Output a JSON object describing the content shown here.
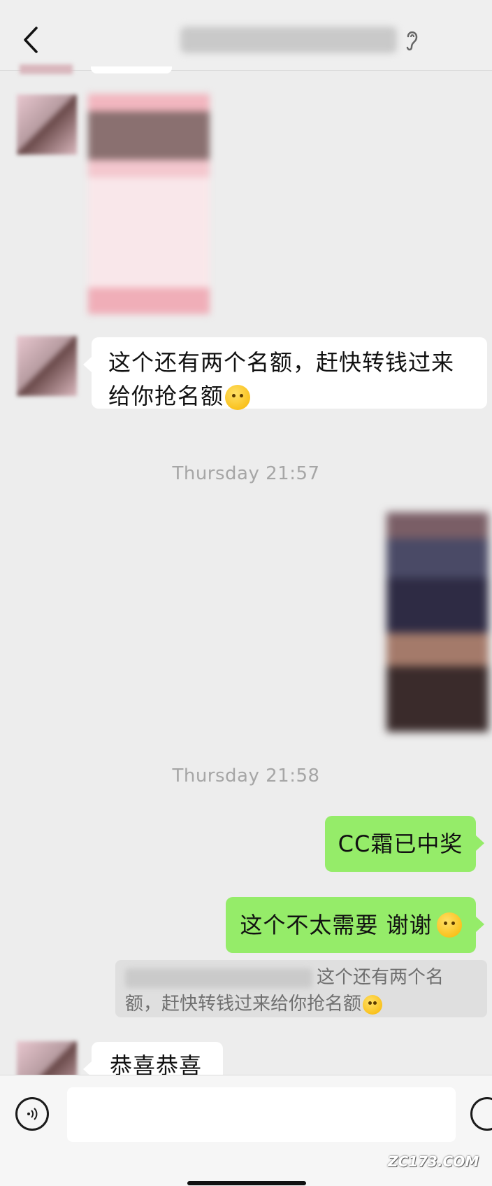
{
  "header": {
    "back_icon": "chevron-left-icon",
    "title": "",
    "ear_icon": "ear-icon"
  },
  "messages": [
    {
      "side": "left",
      "type": "image"
    },
    {
      "side": "left",
      "type": "text",
      "line1": "这个还有两个名额，赶快转钱过来",
      "line2": "给你抢名额",
      "emoji": "wink-tongue-emoji"
    }
  ],
  "timestamps": [
    "Thursday 21:57",
    "Thursday 21:58"
  ],
  "right_messages": [
    {
      "text": "CC霜已中奖"
    },
    {
      "text": "这个不太需要 谢谢",
      "emoji": "blush-emoji"
    }
  ],
  "quote": {
    "line1": "这个还有两个名",
    "line2": "额，赶快转钱过来给你抢名额"
  },
  "last_message": {
    "text": "恭喜恭喜"
  },
  "input_bar": {
    "voice_icon": "voice-icon",
    "emoji_icon": "emoji-icon"
  },
  "watermark": "ZC173.COM",
  "colors": {
    "green_bubble": "#95ec69",
    "background": "#ededed"
  }
}
